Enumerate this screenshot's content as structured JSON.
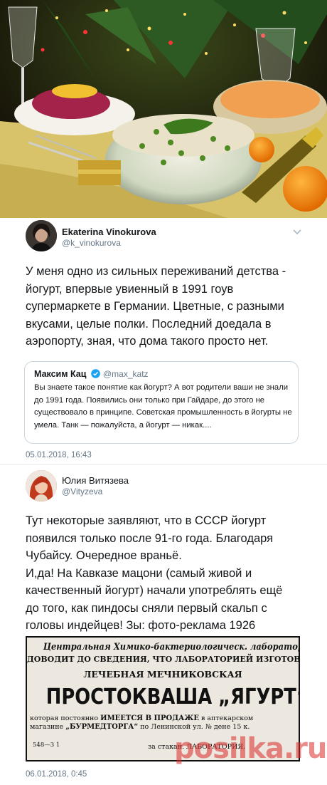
{
  "tweet1": {
    "author_name": "Ekaterina Vinokurova",
    "author_handle": "@k_vinokurova",
    "text": "У меня одно из сильных переживаний детства - йогурт, впервые увиенный в 1991 гоув супермаркете в Германии. Цветные, с разными вкусами, целые полки. Последний доедала в аэропорту, зная, что дома такого просто нет.",
    "quote": {
      "author_name": "Максим Кац",
      "author_handle": "@max_katz",
      "text": "Вы знаете такое понятие как йогурт? А вот родители ваши не знали до 1991 года. Появились они только при Гайдаре, до этого не существовало в принципе. Советская промышленность в йогурты не умела. Танк — пожалуйста, а йогурт — никак...."
    },
    "timestamp": "05.01.2018, 16:43"
  },
  "tweet2": {
    "author_name": "Юлия Витязева",
    "author_handle": "@Vityzeva",
    "text": "Тут некоторые заявляют, что в СССР йогурт появился  только после 91-го года. Благодаря Чубайсу. Очередное враньё.\nИ,да! На Кавказе мацони (самый живой и качественный йогурт) начали употреблять ещё до того, как пиндосы сняли первый скальп с головы индейцев! Зы: фото-реклама 1926",
    "timestamp": "06.01.2018, 0:45"
  },
  "advert": {
    "line1": "Центральная Химико-бактериологическ. лаборатория Бурнаркомздрава",
    "line2": "ДОВОДИТ ДО СВЕДЕНИЯ, ЧТО ЛАБОРАТОРИЕЙ ИЗГОТОВЛЯЕТСЯ",
    "line3": "ЛЕЧЕБНАЯ МЕЧНИКОВСКАЯ",
    "line4": "ПРОСТОКВАША „ЯГУРТ“,",
    "line5a": "которая постоянно ",
    "line5b": "ИМЕЕТСЯ В ПРОДАЖЕ",
    "line5c": " в аптекарском",
    "line6a": "магазине ",
    "line6b": "„БУРМЕДТОРГА“",
    "line6c": " по Ленинской ул. № дене 15 к.",
    "code": "548—3 1",
    "price": "за стакан.   ЛАБОРАТОРИЯ."
  },
  "watermark": "posilka.ru",
  "icons": {
    "menu": "chevron-down-icon",
    "verified": "verified-badge-icon"
  },
  "colors": {
    "text": "#14171a",
    "secondary": "#657786",
    "border": "#ccd6dd",
    "verified": "#1da1f2"
  }
}
